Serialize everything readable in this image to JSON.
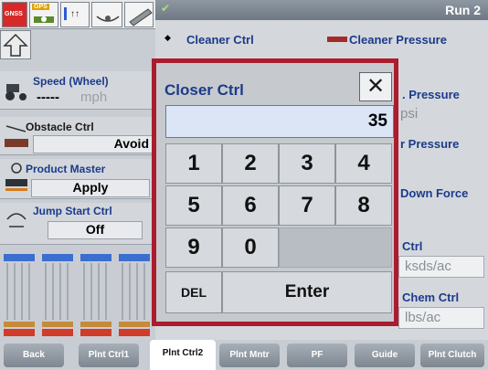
{
  "status_strip": {
    "warning_badge": "GNSS",
    "gps_badge": "GPS",
    "icons": [
      "warning-icon",
      "gps-icon",
      "implement-icon",
      "drill-icon"
    ]
  },
  "left_column": {
    "speed": {
      "label": "Speed (Wheel)",
      "value": "-----",
      "unit": "mph"
    },
    "obstacle": {
      "label": "Obstacle Ctrl",
      "value": "Avoid"
    },
    "product_master": {
      "label": "Product Master",
      "value": "Apply"
    },
    "jump_start": {
      "label": "Jump Start Ctrl",
      "value": "Off"
    }
  },
  "topbar": {
    "run_label": "Run 2"
  },
  "right_panel": {
    "cleaner_ctrl": {
      "label": "Cleaner Ctrl"
    },
    "cleaner_pressure": {
      "label": "Cleaner Pressure"
    },
    "pressure_1": {
      "label_fragment": ". Pressure",
      "unit": "psi"
    },
    "pressure_2": {
      "label_fragment": "r Pressure"
    },
    "down_force": {
      "label_fragment": "Down Force"
    },
    "ctrl": {
      "label_fragment": "Ctrl",
      "unit": "ksds/ac"
    },
    "chem_ctrl": {
      "label_fragment": "Chem Ctrl",
      "unit": "lbs/ac"
    }
  },
  "dialog": {
    "title": "Closer Ctrl",
    "close_label": "✕",
    "value": "35",
    "keys": {
      "k1": "1",
      "k2": "2",
      "k3": "3",
      "k4": "4",
      "k5": "5",
      "k6": "6",
      "k7": "7",
      "k8": "8",
      "k9": "9",
      "k0": "0",
      "del": "DEL",
      "enter": "Enter"
    }
  },
  "bottom_nav": {
    "tabs": [
      "Back",
      "Plnt Ctrl1",
      "Plnt Ctrl2",
      "Plnt Mntr",
      "PF",
      "Guide",
      "Plnt Clutch"
    ],
    "active_tab": "Plnt Ctrl2"
  },
  "colors": {
    "dialog_border": "#ab1c2e",
    "label_blue": "#1c3a8a",
    "input_bg": "#dbe5f6"
  }
}
